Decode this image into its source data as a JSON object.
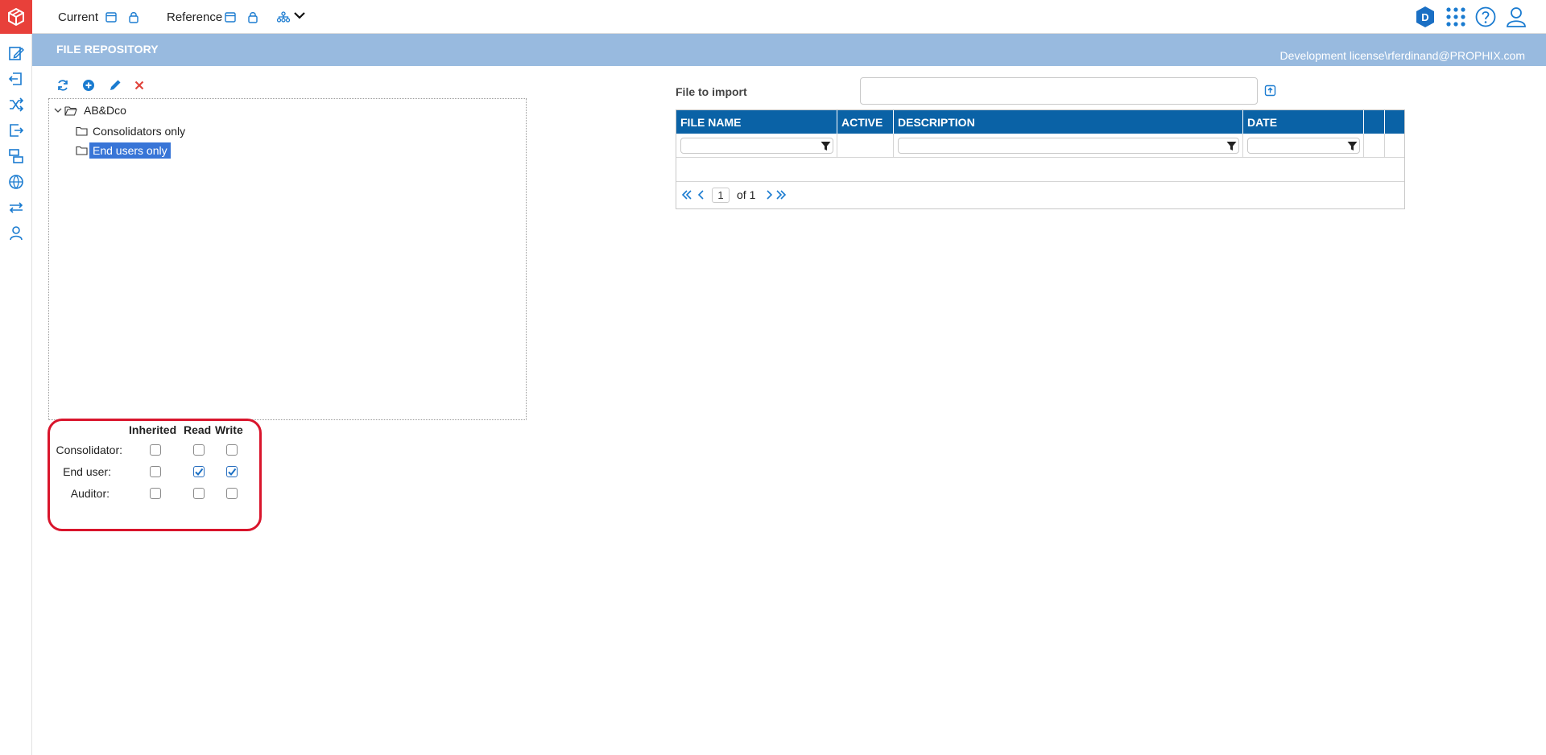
{
  "topbar": {
    "current_label": "Current",
    "reference_label": "Reference"
  },
  "header": {
    "title": "FILE REPOSITORY",
    "license": "Development license\\rferdinand@PROPHIX.com"
  },
  "tree": {
    "root": "AB&Dco",
    "children": [
      {
        "label": "Consolidators only",
        "selected": false
      },
      {
        "label": "End users only",
        "selected": true
      }
    ]
  },
  "permissions": {
    "headers": [
      "Inherited",
      "Read",
      "Write"
    ],
    "rows": [
      {
        "label": "Consolidator:",
        "inherited": false,
        "read": false,
        "write": false
      },
      {
        "label": "End user:",
        "inherited": false,
        "read": true,
        "write": true
      },
      {
        "label": "Auditor:",
        "inherited": false,
        "read": false,
        "write": false
      }
    ]
  },
  "import": {
    "label": "File to import",
    "value": ""
  },
  "grid": {
    "columns": [
      "FILE NAME",
      "ACTIVE",
      "DESCRIPTION",
      "DATE"
    ],
    "rows": [],
    "pager": {
      "page": "1",
      "of_text": "of 1"
    }
  },
  "user_badge_letter": "D",
  "colors": {
    "brand": "#e8403a",
    "header_strip": "#98badf",
    "grid_header": "#0a62a6",
    "accent_icon": "#1a7bd0",
    "delete_icon": "#e0443c",
    "selection": "#3875d7",
    "highlight_border": "#d9152c"
  }
}
